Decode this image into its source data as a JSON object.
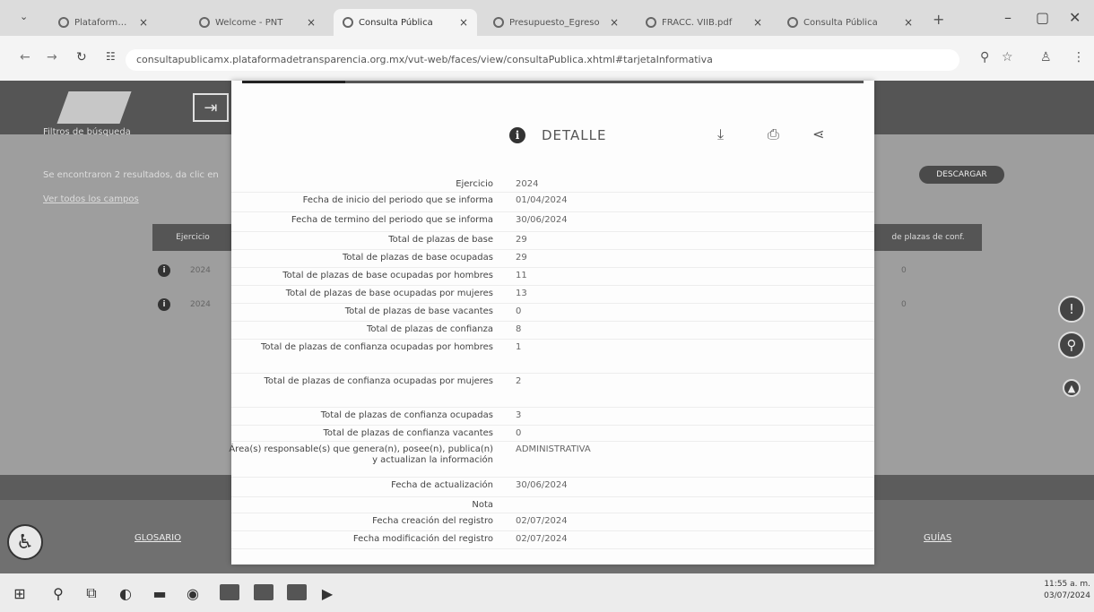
{
  "browser": {
    "tabs": [
      {
        "title": "Plataforma de Transp",
        "active": false
      },
      {
        "title": "Welcome - PNT",
        "active": false
      },
      {
        "title": "Consulta Pública",
        "active": true
      },
      {
        "title": "Presupuesto_Egreso",
        "active": false
      },
      {
        "title": "FRACC. VIIB.pdf",
        "active": false
      },
      {
        "title": "Consulta Pública",
        "active": false
      }
    ],
    "url": "consultapublicamx.plataformadetransparencia.org.mx/vut-web/faces/view/consultaPublica.xhtml#tarjetaInformativa"
  },
  "background_page": {
    "filters_label": "Filtros de búsqueda",
    "results_text": "Se encontraron 2 resultados, da clic en",
    "all_fields_link": "Ver todos los campos",
    "download_button": "DESCARGAR",
    "table_header_left": "Ejercicio",
    "table_header_right": "de plazas de conf.",
    "rows": [
      {
        "left": "2024",
        "right": "0"
      },
      {
        "left": "2024",
        "right": "0"
      }
    ],
    "footer_links": {
      "glossary": "GLOSARIO",
      "guides": "GUÍAS"
    }
  },
  "modal": {
    "title": "DETALLE",
    "info_icon": "info-icon",
    "actions": [
      "download-icon",
      "print-icon",
      "share-icon"
    ],
    "rows": [
      {
        "label": "Ejercicio",
        "value": "2024"
      },
      {
        "label": "Fecha de inicio del periodo que se informa",
        "value": "01/04/2024"
      },
      {
        "label": "Fecha de termino del periodo que se informa",
        "value": "30/06/2024"
      },
      {
        "label": "Total de plazas de base",
        "value": "29"
      },
      {
        "label": "Total de plazas de base ocupadas",
        "value": "29"
      },
      {
        "label": "Total de plazas de base ocupadas por hombres",
        "value": "11"
      },
      {
        "label": "Total de plazas de base ocupadas por mujeres",
        "value": "13"
      },
      {
        "label": "Total de plazas de base vacantes",
        "value": "0"
      },
      {
        "label": "Total de plazas de confianza",
        "value": "8"
      },
      {
        "label": "Total de plazas de confianza ocupadas por hombres",
        "value": "1"
      },
      {
        "label": "Total de plazas de confianza ocupadas por mujeres",
        "value": "2"
      },
      {
        "label": "Total de plazas de confianza ocupadas",
        "value": "3"
      },
      {
        "label": "Total de plazas de confianza vacantes",
        "value": "0"
      },
      {
        "label": "Área(s) responsable(s) que genera(n), posee(n), publica(n) y actualizan la información",
        "value": "ADMINISTRATIVA"
      },
      {
        "label": "Fecha de actualización",
        "value": "30/06/2024"
      },
      {
        "label": "Nota",
        "value": ""
      },
      {
        "label": "Fecha creación del registro",
        "value": "02/07/2024"
      },
      {
        "label": "Fecha modificación del registro",
        "value": "02/07/2024"
      }
    ]
  },
  "taskbar": {
    "time": "11:55 a. m.",
    "date": "03/07/2024"
  }
}
